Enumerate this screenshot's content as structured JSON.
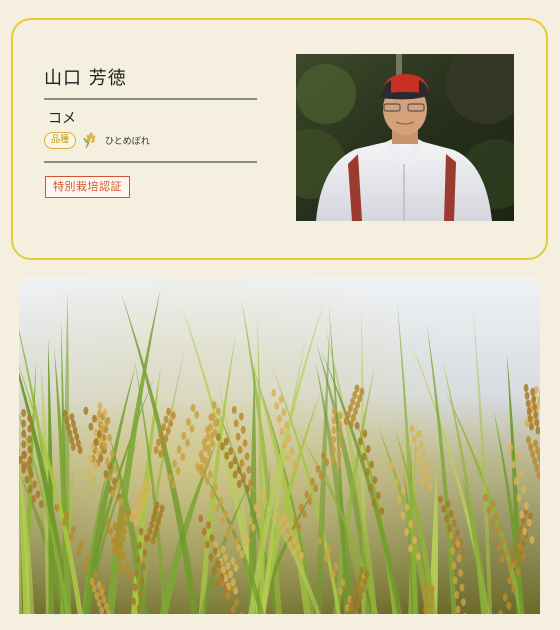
{
  "profile": {
    "name": "山口 芳徳",
    "crop": "コメ",
    "variety_label": "品種",
    "variety_icon": "rice-stalk-icon",
    "variety_name": "ひとめぼれ",
    "certification": "特別栽培認証"
  },
  "colors": {
    "background": "#f5efdf",
    "card_border": "#e6c93c",
    "rule": "#8a8a86",
    "badge_text": "#c49a1e",
    "cert": "#d2542a"
  }
}
